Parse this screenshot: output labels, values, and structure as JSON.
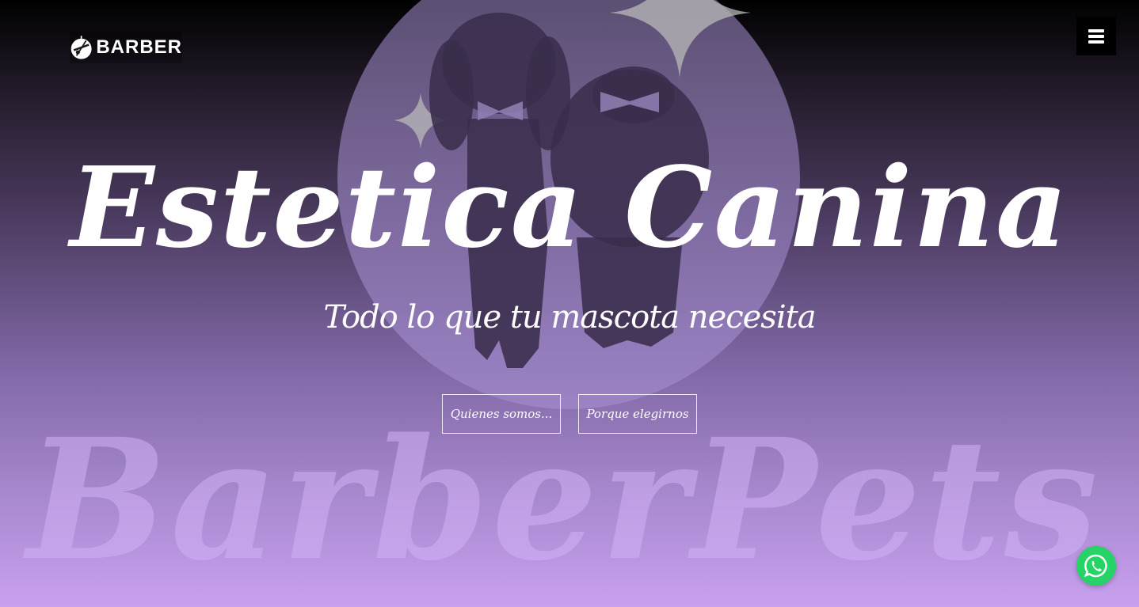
{
  "header": {
    "logo_text": "BARBER",
    "menu_icon": "hamburger-menu-icon"
  },
  "hero": {
    "title": "Estetica Canina",
    "subtitle": "Todo lo que tu mascota necesita",
    "watermark_text": "BarberPets",
    "buttons": [
      {
        "label": "Quienes somos..."
      },
      {
        "label": "Porque elegirnos"
      }
    ]
  },
  "floating": {
    "whatsapp_icon": "whatsapp-icon",
    "whatsapp_color": "#25d366"
  },
  "colors": {
    "gradient_top": "#000000",
    "gradient_bottom": "#c9a0ef",
    "circle": "#9b84c4"
  }
}
